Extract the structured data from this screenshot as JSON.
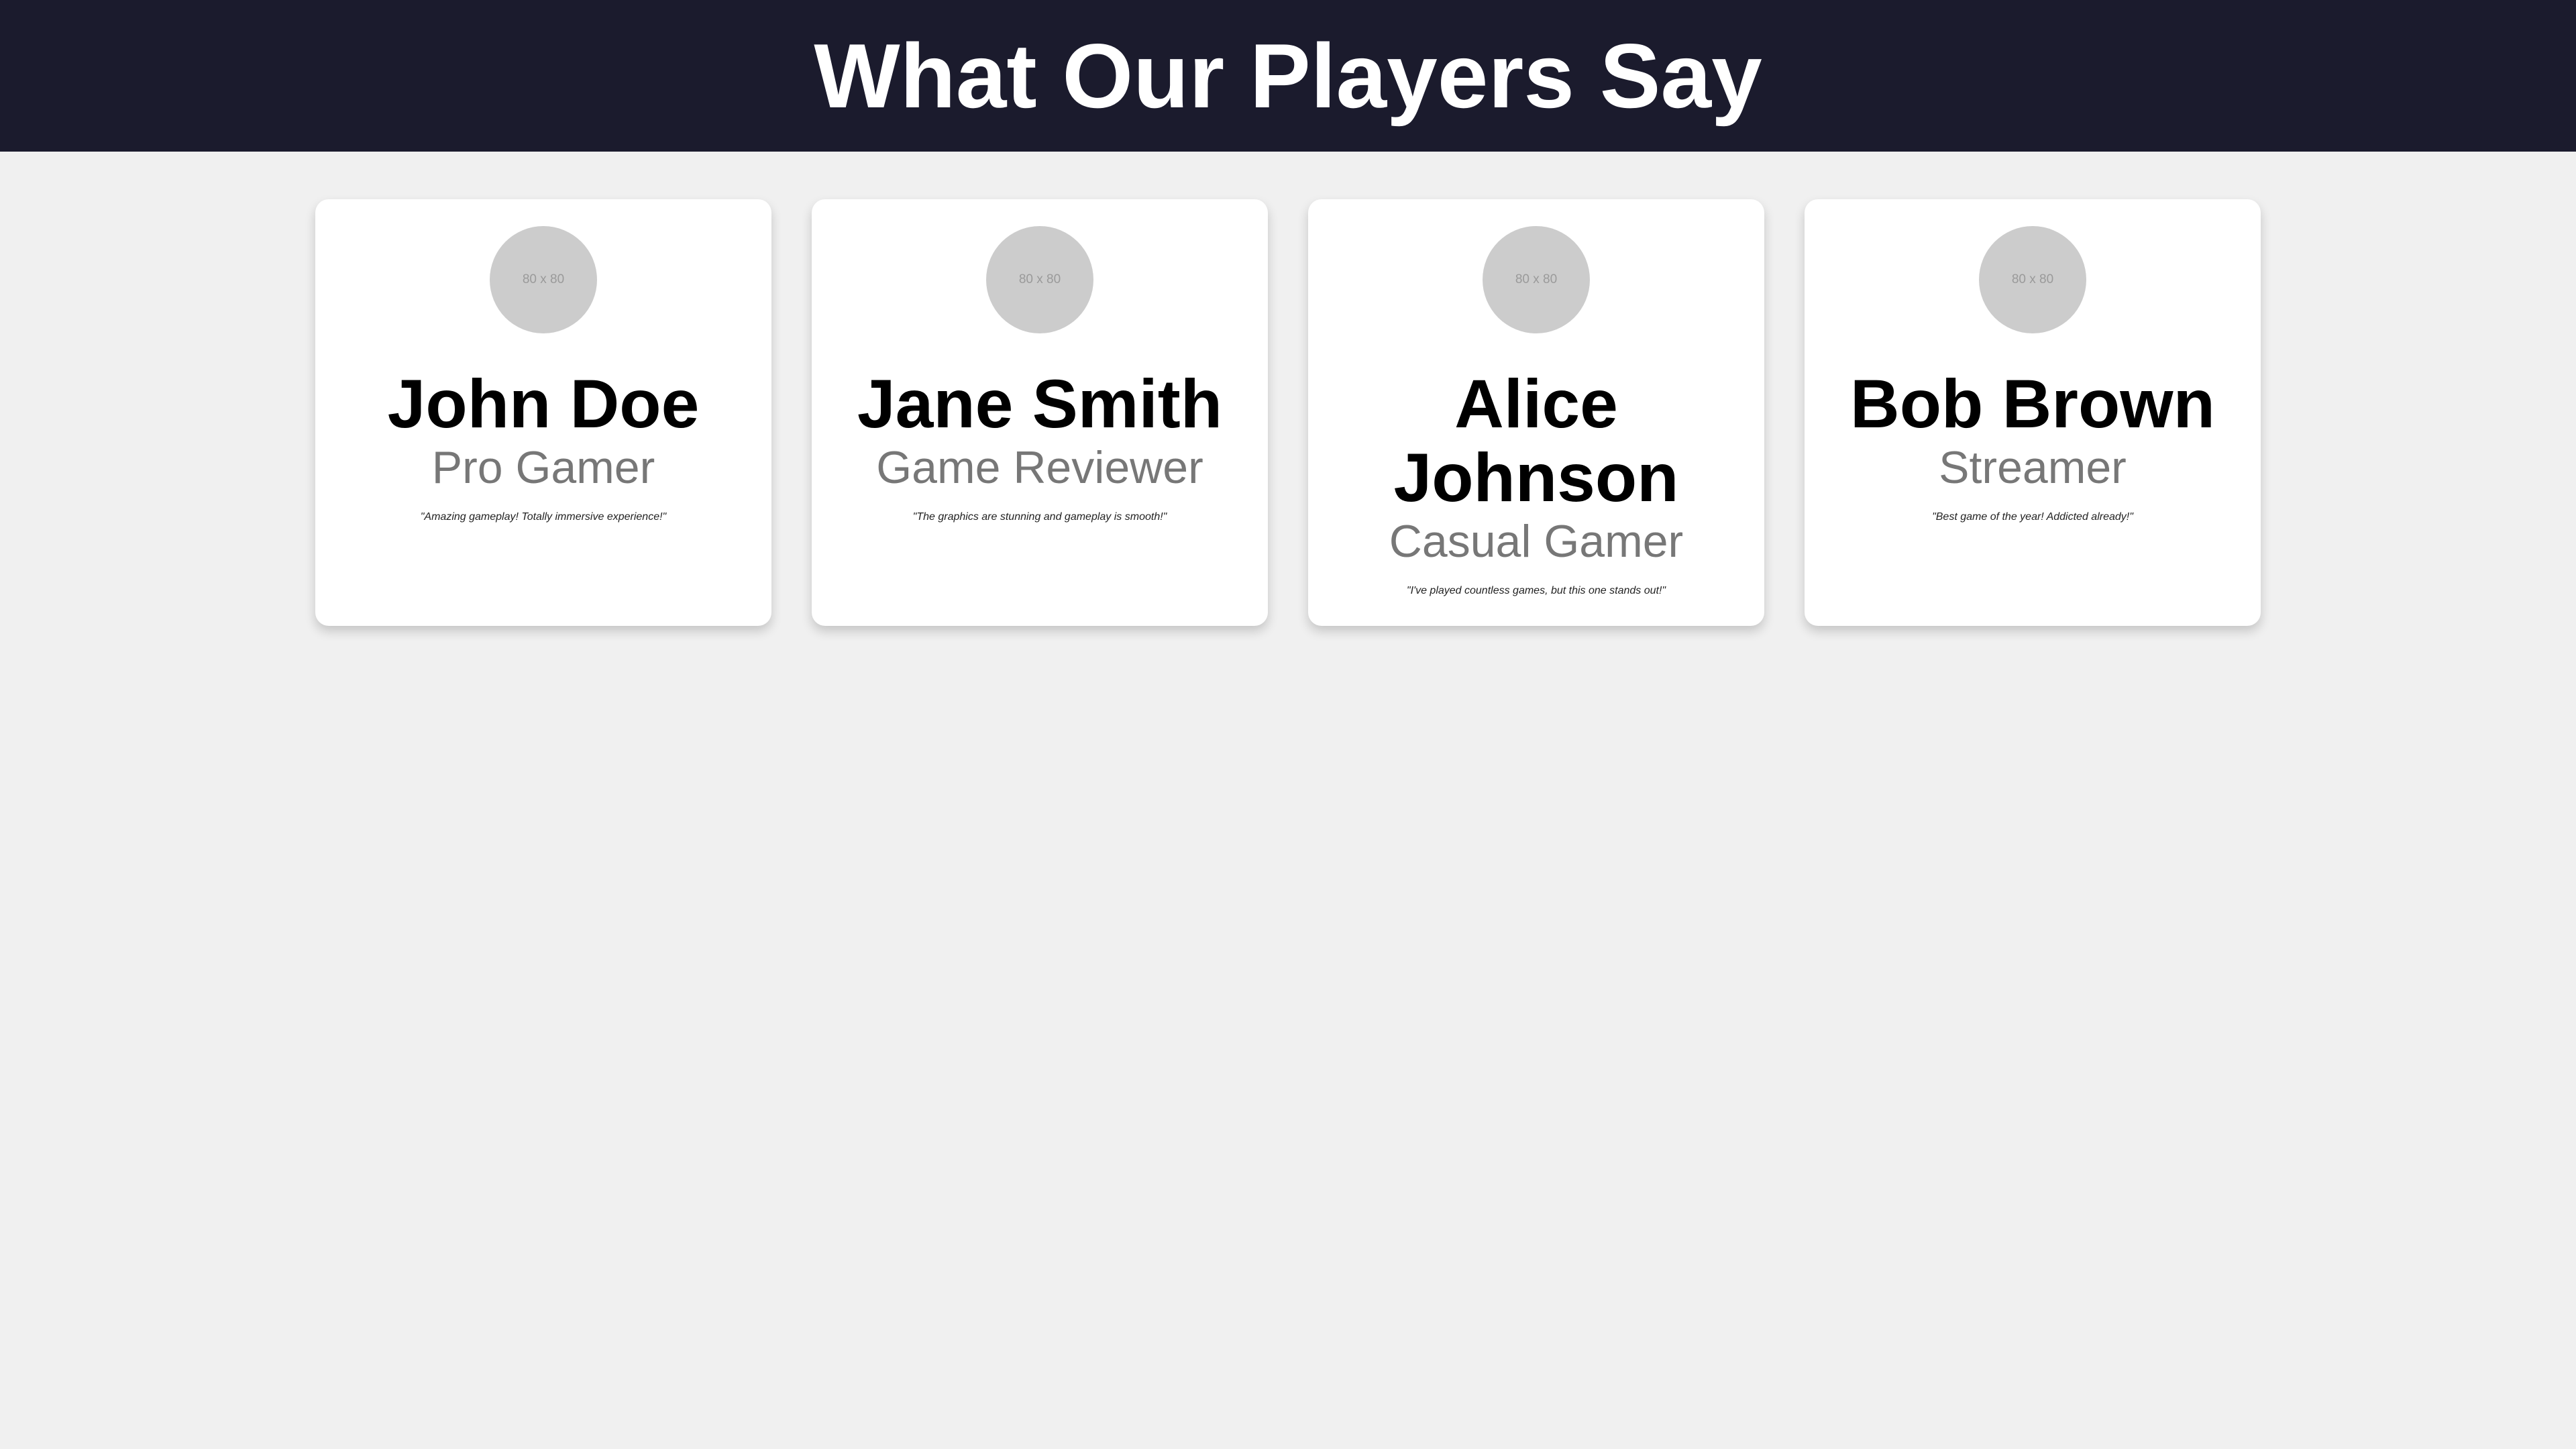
{
  "header": {
    "title": "What Our Players Say"
  },
  "testimonials": [
    {
      "avatar_text": "80 x 80",
      "name": "John Doe",
      "role": "Pro Gamer",
      "quote": "\"Amazing gameplay! Totally immersive experience!\""
    },
    {
      "avatar_text": "80 x 80",
      "name": "Jane Smith",
      "role": "Game Reviewer",
      "quote": "\"The graphics are stunning and gameplay is smooth!\""
    },
    {
      "avatar_text": "80 x 80",
      "name": "Alice Johnson",
      "role": "Casual Gamer",
      "quote": "\"I've played countless games, but this one stands out!\""
    },
    {
      "avatar_text": "80 x 80",
      "name": "Bob Brown",
      "role": "Streamer",
      "quote": "\"Best game of the year! Addicted already!\""
    }
  ]
}
